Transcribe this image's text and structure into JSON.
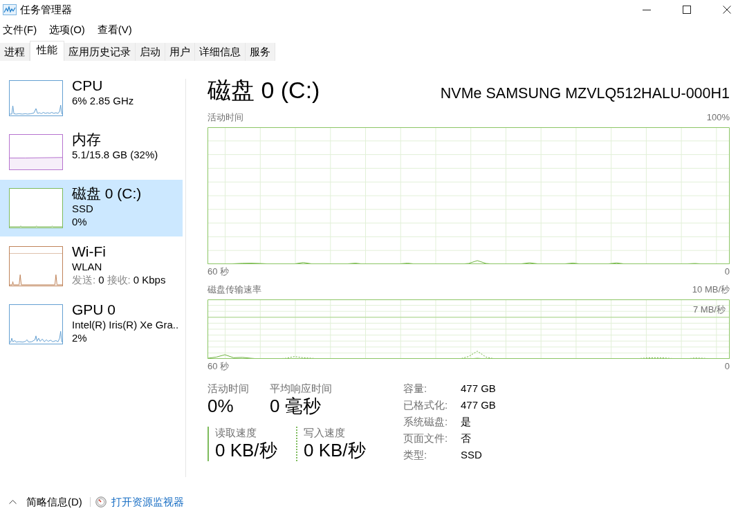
{
  "window": {
    "title": "任务管理器"
  },
  "menu": [
    {
      "label": "文件(F)"
    },
    {
      "label": "选项(O)"
    },
    {
      "label": "查看(V)"
    }
  ],
  "tabs": [
    {
      "label": "进程",
      "selected": false
    },
    {
      "label": "性能",
      "selected": true
    },
    {
      "label": "应用历史记录",
      "selected": false
    },
    {
      "label": "启动",
      "selected": false
    },
    {
      "label": "用户",
      "selected": false
    },
    {
      "label": "详细信息",
      "selected": false
    },
    {
      "label": "服务",
      "selected": false
    }
  ],
  "sidebar": {
    "items": [
      {
        "kind": "cpu",
        "title": "CPU",
        "lines": [
          "6% 2.85 GHz"
        ],
        "color": "#64a0d2",
        "selected": false
      },
      {
        "kind": "memory",
        "title": "内存",
        "lines": [
          "5.1/15.8 GB (32%)"
        ],
        "color": "#b673cf",
        "selected": false
      },
      {
        "kind": "disk",
        "title": "磁盘 0 (C:)",
        "lines": [
          "SSD",
          "0%"
        ],
        "color": "#7dbb5c",
        "selected": true
      },
      {
        "kind": "network",
        "title": "Wi-Fi",
        "lines": [
          "WLAN"
        ],
        "rates": [
          {
            "label": "发送:",
            "value": "0"
          },
          {
            "label": "接收:",
            "value": "0 Kbps"
          }
        ],
        "color": "#c0845a",
        "selected": false
      },
      {
        "kind": "gpu",
        "title": "GPU 0",
        "lines": [
          "Intel(R) Iris(R) Xe Gra..",
          "2%"
        ],
        "color": "#64a0d2",
        "selected": false
      }
    ]
  },
  "detail": {
    "title": "磁盘 0 (C:)",
    "model": "NVMe SAMSUNG MZVLQ512HALU-000H1",
    "graphs": [
      {
        "kind": "activity",
        "title": "活动时间",
        "scale": "100%",
        "start": "60 秒",
        "end": "0"
      },
      {
        "kind": "transfer",
        "title": "磁盘传输速率",
        "scale": "10 MB/秒",
        "marker": "7 MB/秒",
        "start": "60 秒",
        "end": "0"
      }
    ],
    "stats": [
      {
        "label": "活动时间",
        "value": "0%"
      },
      {
        "label": "平均响应时间",
        "value": "0 毫秒"
      }
    ],
    "speeds": [
      {
        "kind": "solid",
        "label": "读取速度",
        "value": "0 KB/秒"
      },
      {
        "kind": "dotted",
        "label": "写入速度",
        "value": "0 KB/秒"
      }
    ],
    "properties": [
      {
        "label": "容量:",
        "value": "477 GB"
      },
      {
        "label": "已格式化:",
        "value": "477 GB"
      },
      {
        "label": "系统磁盘:",
        "value": "是"
      },
      {
        "label": "页面文件:",
        "value": "否"
      },
      {
        "label": "类型:",
        "value": "SSD"
      }
    ]
  },
  "footer": {
    "toggle": "简略信息(D)",
    "link": "打开资源监视器"
  }
}
